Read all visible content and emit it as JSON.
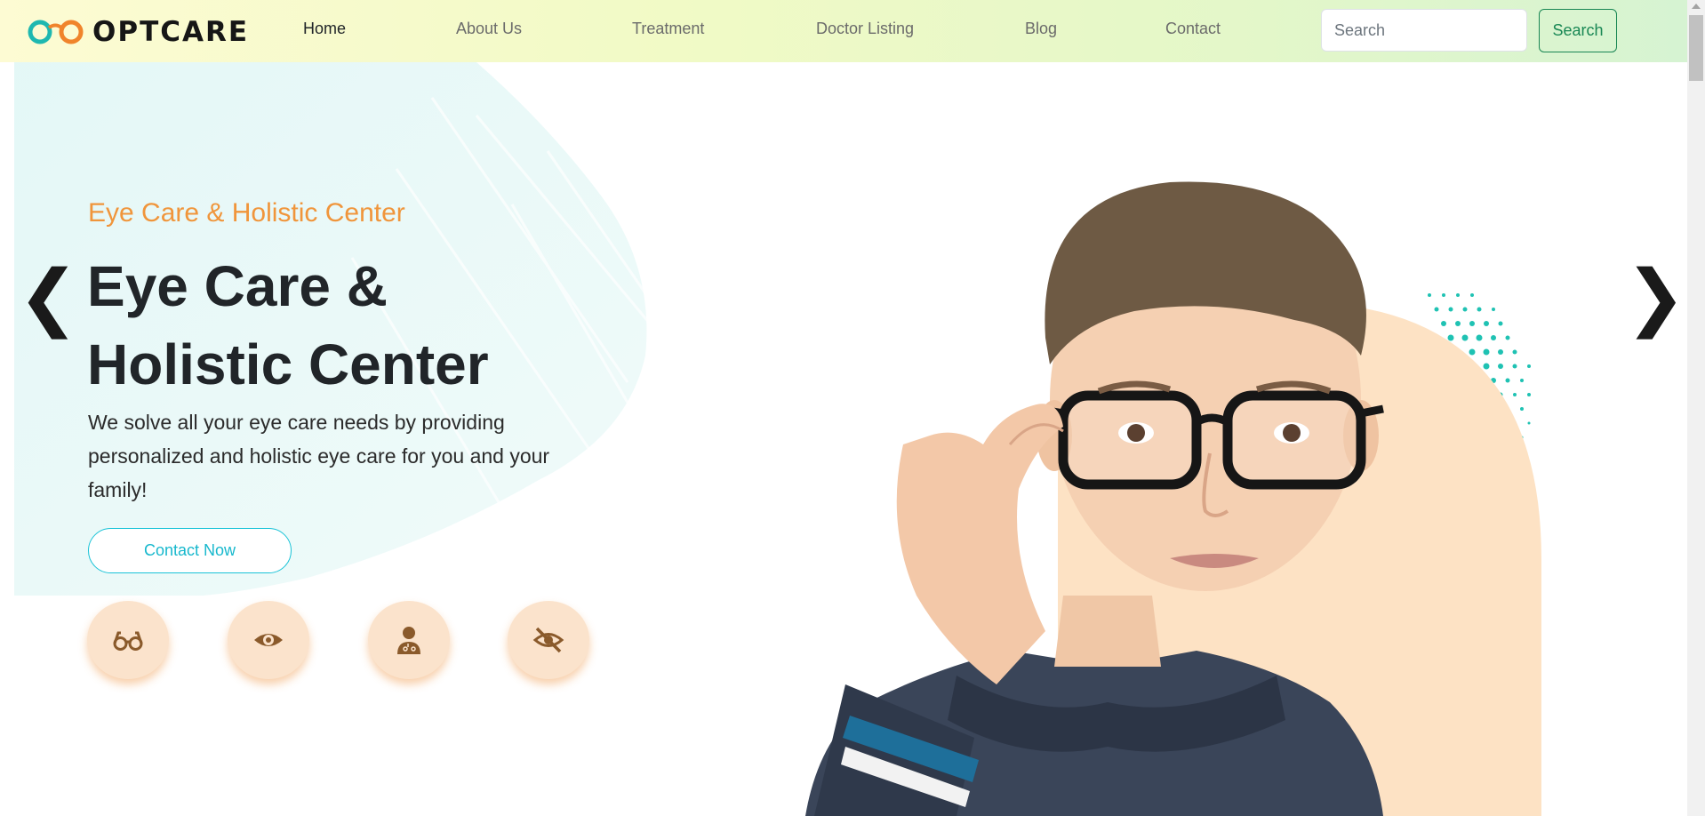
{
  "brand": {
    "name": "OPTCARE"
  },
  "nav": {
    "items": [
      {
        "label": "Home",
        "active": true
      },
      {
        "label": "About Us"
      },
      {
        "label": "Treatment"
      },
      {
        "label": "Doctor Listing"
      },
      {
        "label": "Blog"
      },
      {
        "label": "Contact"
      }
    ],
    "search": {
      "placeholder": "Search",
      "button_label": "Search"
    }
  },
  "hero": {
    "subtitle": "Eye Care & Holistic Center",
    "title": "Eye Care & Holistic Center",
    "description": "We solve all your eye care needs by providing personalized and holistic eye care for you and your family!",
    "cta_label": "Contact Now",
    "features": [
      "glasses-icon",
      "eye-icon",
      "doctor-icon",
      "eye-slash-icon"
    ],
    "prev_arrow": "❮",
    "next_arrow": "❯"
  },
  "colors": {
    "accent_orange": "#f0953b",
    "accent_teal": "#19c3d7",
    "icon_brown": "#8a5a2b",
    "feature_bg": "#fbe3cc",
    "search_green": "#198754"
  }
}
